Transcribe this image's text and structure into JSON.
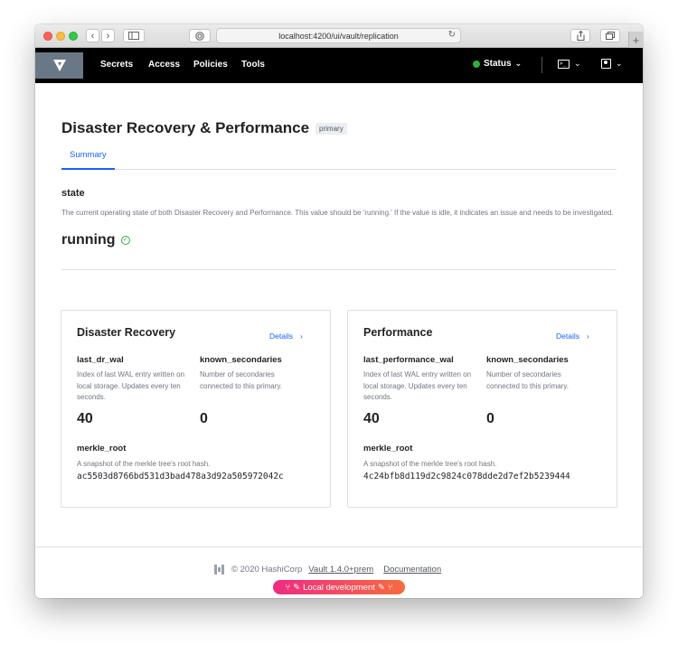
{
  "browser": {
    "url": "localhost:4200/ui/vault/replication",
    "plus_tab": "+"
  },
  "nav": {
    "items": [
      "Secrets",
      "Access",
      "Policies",
      "Tools"
    ],
    "status_label": "Status",
    "status_color": "#2eb039"
  },
  "page": {
    "title": "Disaster Recovery & Performance",
    "badge": "primary",
    "tabs": [
      "Summary"
    ]
  },
  "state": {
    "label": "state",
    "help": "The current operating state of both Disaster Recovery and Performance. This value should be 'running.' If the value is idle, it indicates an issue and needs to be investigated.",
    "value": "running"
  },
  "cards": [
    {
      "title": "Disaster Recovery",
      "details": "Details",
      "wal_label": "last_dr_wal",
      "wal_help": "Index of last WAL entry written on local storage. Updates every ten seconds.",
      "wal_value": "40",
      "secondaries_label": "known_secondaries",
      "secondaries_help": "Number of secondaries connected to this primary.",
      "secondaries_value": "0",
      "merkle_label": "merkle_root",
      "merkle_help": "A snapshot of the merkle tree's root hash.",
      "merkle_value": "ac5503d8766bd531d3bad478a3d92a505972042c"
    },
    {
      "title": "Performance",
      "details": "Details",
      "wal_label": "last_performance_wal",
      "wal_help": "Index of last WAL entry written on local storage. Updates every ten seconds.",
      "wal_value": "40",
      "secondaries_label": "known_secondaries",
      "secondaries_help": "Number of secondaries connected to this primary.",
      "secondaries_value": "0",
      "merkle_label": "merkle_root",
      "merkle_help": "A snapshot of the merkle tree's root hash.",
      "merkle_value": "4c24bfb8d119d2c9824c078dde2d7ef2b5239444"
    }
  ],
  "footer": {
    "copyright": "© 2020 HashiCorp",
    "version_link": "Vault 1.4.0+prem",
    "docs_link": "Documentation",
    "env_label": "Local development"
  },
  "colors": {
    "accent": "#1563ff",
    "success": "#2eb039",
    "env_gradient_start": "#ef2a82",
    "env_gradient_end": "#f76b3e"
  }
}
